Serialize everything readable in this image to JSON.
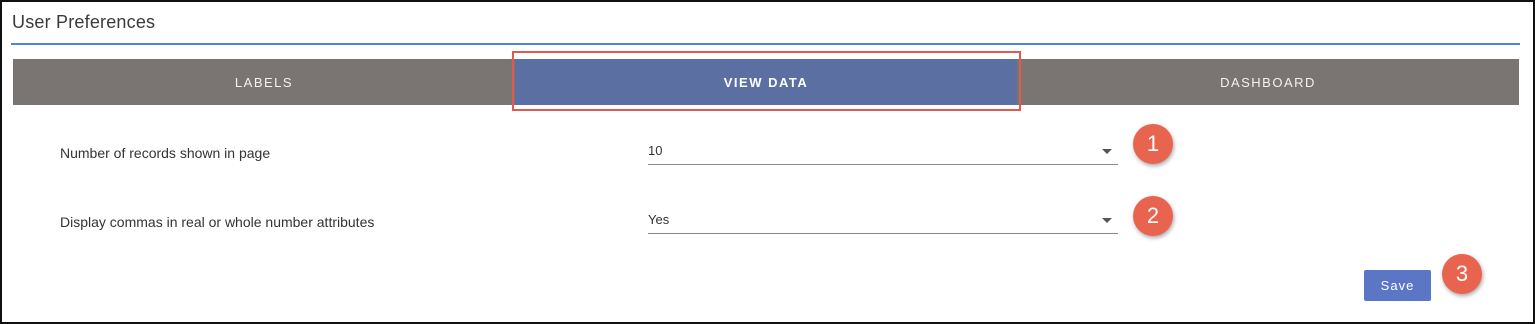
{
  "header": {
    "title": "User Preferences"
  },
  "tabs": [
    {
      "label": "LABELS",
      "active": false
    },
    {
      "label": "VIEW DATA",
      "active": true
    },
    {
      "label": "DASHBOARD",
      "active": false
    }
  ],
  "colors": {
    "accent_rule": "#4f86c6",
    "tabbar_bg": "#7a7573",
    "active_tab": "#5c6fa3",
    "highlight_border": "#e05a4f",
    "badge": "#e8644f",
    "save_button": "#5b76c4"
  },
  "preferences": [
    {
      "label": "Number of records shown in page",
      "value": "10",
      "icon": "chevron-down-icon"
    },
    {
      "label": "Display commas in real or whole number attributes",
      "value": "Yes",
      "icon": "chevron-down-icon"
    }
  ],
  "callouts": [
    "1",
    "2",
    "3"
  ],
  "actions": {
    "save_label": "Save"
  }
}
